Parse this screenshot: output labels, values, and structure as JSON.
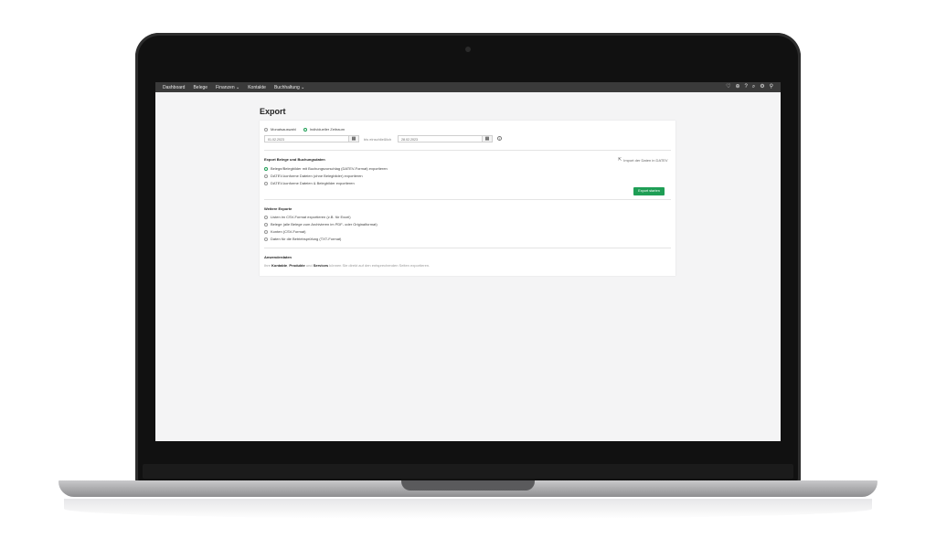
{
  "nav": {
    "items": [
      "Dashboard",
      "Belege",
      "Finanzen ⌄",
      "Kontakte",
      "Buchhaltung ⌄"
    ],
    "icons": [
      "heart-icon",
      "plus-icon",
      "help-icon",
      "search-icon",
      "gear-icon",
      "user-icon"
    ]
  },
  "page": {
    "title": "Export"
  },
  "period": {
    "option_month": "Monatsauswahl",
    "option_custom": "Individueller Zeitraum",
    "from_value": "01.02.2023",
    "between_label": "bis einschließlich",
    "to_value": "28.02.2023"
  },
  "export_section": {
    "title": "Export Belege und Buchungsdaten",
    "import_link": "Import der Daten in DATEV",
    "options": [
      "Belege/Belegbilder mit Buchungsvorschlag (DATEV-Format) exportieren",
      "DATEV-konforme Dateien (ohne Belegbilder) exportieren",
      "DATEV-konforme Dateien & Belegbilder exportieren"
    ],
    "start_button": "Export starten"
  },
  "other_exports": {
    "title": "Weitere Exporte",
    "options": [
      "Listen im CSV-Format exportieren (z.B. für Excel)",
      "Belege (alle Belege zum Archivieren im PDF- oder Originalformat)",
      "Konten (CSV-Format)",
      "Daten für die Betriebsprüfung (TXT-Format)"
    ]
  },
  "user_data": {
    "title": "Anwenderdaten",
    "text_prefix": "Ihre",
    "link1": "Kontakte",
    "sep1": ",",
    "link2": "Produkte",
    "sep2": "und",
    "link3": "Services",
    "text_suffix": "können Sie direkt auf den entsprechenden Seiten exportieren."
  },
  "colors": {
    "accent": "#1e9e55",
    "topbar": "#3a3a3a"
  }
}
